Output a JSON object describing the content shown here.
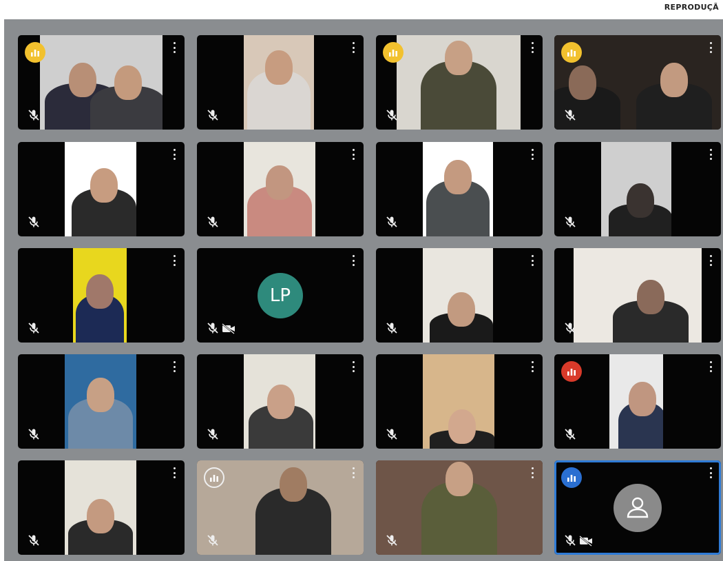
{
  "credit": "REPRODUÇÃ",
  "icons": {
    "more": "more-vert-icon",
    "mic_off": "mic-off-icon",
    "cam_off": "videocam-off-icon",
    "speaking": "speaking-level-icon",
    "person": "person-icon"
  },
  "colors": {
    "grid_background": "#8a8d90",
    "tile_background": "#050505",
    "active_border": "#2f7bd6",
    "level_yellow": "#f2c12e",
    "level_red": "#d83a2a",
    "level_blue": "#2a6fd1",
    "avatar_lp": "#2e8a7c",
    "avatar_person": "#8a8a8a"
  },
  "tiles": [
    {
      "row": 0,
      "col": 0,
      "badge": "yellow"
    },
    {
      "row": 0,
      "col": 1
    },
    {
      "row": 0,
      "col": 2,
      "badge": "yellow"
    },
    {
      "row": 0,
      "col": 3,
      "badge": "yellow"
    },
    {
      "row": 1,
      "col": 0
    },
    {
      "row": 1,
      "col": 1
    },
    {
      "row": 1,
      "col": 2
    },
    {
      "row": 1,
      "col": 3
    },
    {
      "row": 2,
      "col": 0
    },
    {
      "row": 2,
      "col": 1,
      "avatar_initials": "LP",
      "camera_off": true
    },
    {
      "row": 2,
      "col": 2
    },
    {
      "row": 2,
      "col": 3
    },
    {
      "row": 3,
      "col": 0
    },
    {
      "row": 3,
      "col": 1
    },
    {
      "row": 3,
      "col": 2
    },
    {
      "row": 3,
      "col": 3,
      "badge": "red"
    },
    {
      "row": 4,
      "col": 0
    },
    {
      "row": 4,
      "col": 1,
      "badge": "outline"
    },
    {
      "row": 4,
      "col": 2
    },
    {
      "row": 4,
      "col": 3,
      "badge": "blue",
      "camera_off": true,
      "placeholder_avatar": true,
      "active": true
    }
  ]
}
